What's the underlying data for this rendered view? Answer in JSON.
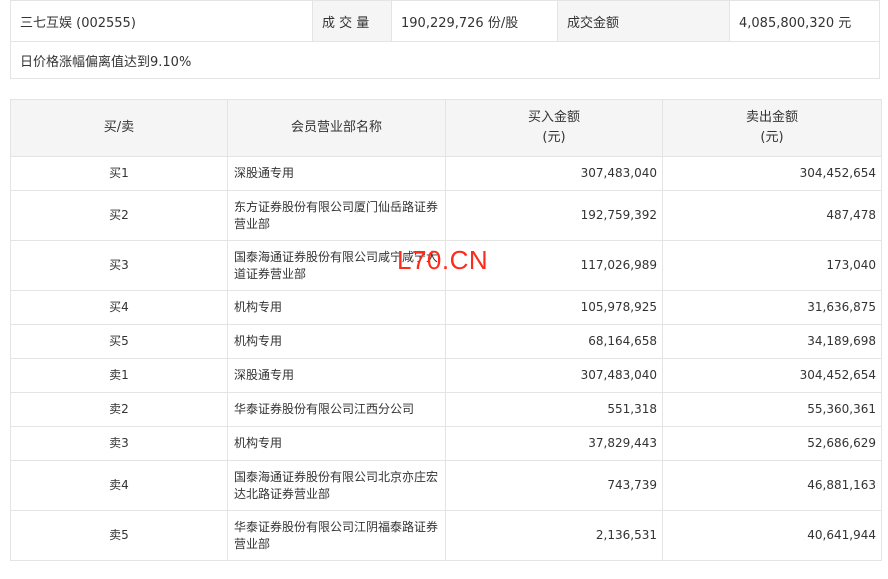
{
  "summary": {
    "stock": "三七互娱 (002555)",
    "volume_label": "成 交 量",
    "volume_value": "190,229,726 份/股",
    "amount_label": "成交金额",
    "amount_value": "4,085,800,320 元",
    "reason": "日价格涨幅偏离值达到9.10%"
  },
  "table": {
    "headers": {
      "side": "买/卖",
      "branch": "会员营业部名称",
      "buy_line1": "买入金额",
      "buy_line2": "(元)",
      "sell_line1": "卖出金额",
      "sell_line2": "(元)"
    },
    "rows": [
      {
        "side": "买1",
        "branch_line1": "深股通专用",
        "branch_line2": "",
        "buy": "307,483,040",
        "sell": "304,452,654"
      },
      {
        "side": "买2",
        "branch_line1": "东方证券股份有限公司厦门仙岳路证券",
        "branch_line2": "营业部",
        "buy": "192,759,392",
        "sell": "487,478"
      },
      {
        "side": "买3",
        "branch_line1": "国泰海通证券股份有限公司咸宁咸宁大",
        "branch_line2": "道证券营业部",
        "buy": "117,026,989",
        "sell": "173,040"
      },
      {
        "side": "买4",
        "branch_line1": "机构专用",
        "branch_line2": "",
        "buy": "105,978,925",
        "sell": "31,636,875"
      },
      {
        "side": "买5",
        "branch_line1": "机构专用",
        "branch_line2": "",
        "buy": "68,164,658",
        "sell": "34,189,698"
      },
      {
        "side": "卖1",
        "branch_line1": "深股通专用",
        "branch_line2": "",
        "buy": "307,483,040",
        "sell": "304,452,654"
      },
      {
        "side": "卖2",
        "branch_line1": "华泰证券股份有限公司江西分公司",
        "branch_line2": "",
        "buy": "551,318",
        "sell": "55,360,361"
      },
      {
        "side": "卖3",
        "branch_line1": "机构专用",
        "branch_line2": "",
        "buy": "37,829,443",
        "sell": "52,686,629"
      },
      {
        "side": "卖4",
        "branch_line1": "国泰海通证券股份有限公司北京亦庄宏",
        "branch_line2": "达北路证券营业部",
        "buy": "743,739",
        "sell": "46,881,163"
      },
      {
        "side": "卖5",
        "branch_line1": "华泰证券股份有限公司江阴福泰路证券",
        "branch_line2": "营业部",
        "buy": "2,136,531",
        "sell": "40,641,944"
      }
    ]
  },
  "watermark": "L70.CN",
  "colors": {
    "border": "#e4e4e4",
    "header_bg": "#f5f5f5",
    "text": "#333333",
    "watermark": "#ff2a1a"
  }
}
